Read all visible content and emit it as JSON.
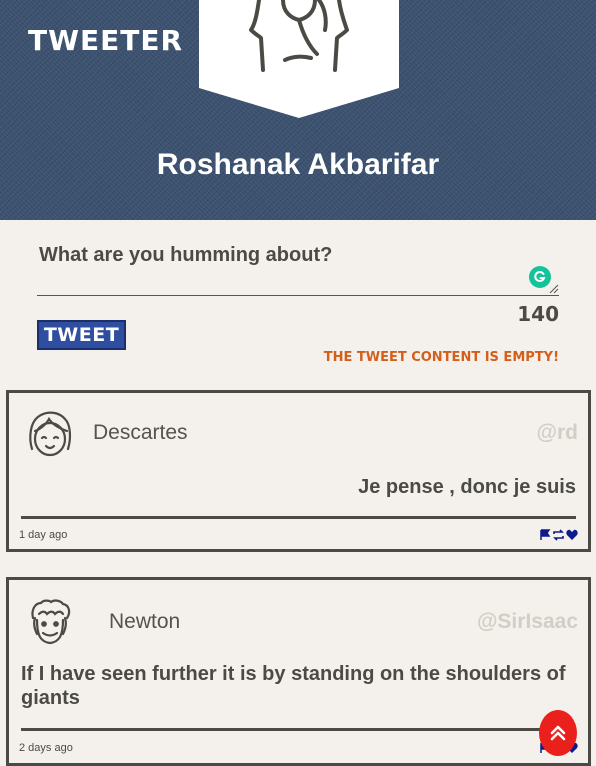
{
  "header": {
    "brand": "TWEETER",
    "profile_name": "Roshanak Akbarifar"
  },
  "composer": {
    "placeholder": "What are you humming about?",
    "value": "",
    "char_count": "140",
    "button_label": "Tweet",
    "error": "The tweet content is empty!"
  },
  "tweets": [
    {
      "name": "Descartes",
      "handle": "@rd",
      "text": "Je pense , donc je suis",
      "time": "1 day ago"
    },
    {
      "name": "Newton",
      "handle": "@SirIsaac",
      "text": "If I have seen further it is by standing on the shoulders of giants",
      "time": "2 days ago"
    }
  ],
  "icons": {
    "flag": "flag-icon",
    "retweet": "retweet-icon",
    "like": "heart-icon",
    "scroll_top": "double-chevron-up-icon"
  },
  "colors": {
    "header_bg": "#3c5270",
    "page_bg": "#f4f1ec",
    "button_bg": "#2f4ea0",
    "error": "#d35f1b",
    "handle": "#d3cec5",
    "action_icons": "#0d1a8c",
    "scroll_top": "#e9201c"
  }
}
